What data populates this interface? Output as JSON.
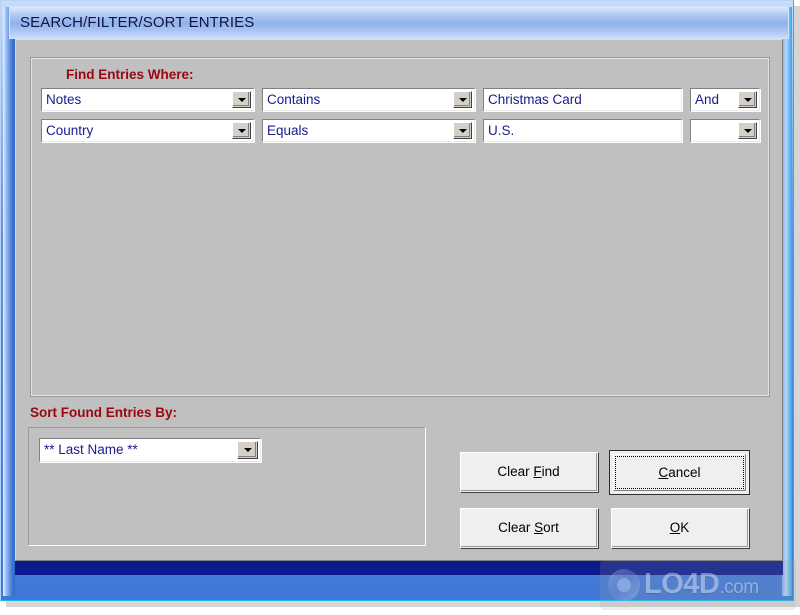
{
  "window": {
    "title": "SEARCH/FILTER/SORT ENTRIES",
    "title_color": "#14133f",
    "frame_color": "#3f78d8",
    "client_bg": "#c0c0c0",
    "label_color": "#9a0710",
    "field_text_color": "#1a1a8c"
  },
  "find_group": {
    "label": "Find Entries Where:",
    "rows": [
      {
        "field_combo": {
          "value": "Notes",
          "arrow": "chevron-down-icon"
        },
        "operator_combo": {
          "value": "Contains",
          "arrow": "chevron-down-icon"
        },
        "value_textbox": {
          "value": "Christmas Card",
          "placeholder": ""
        },
        "conjunction_combo": {
          "value": "And",
          "arrow": "chevron-down-icon"
        }
      },
      {
        "field_combo": {
          "value": "Country",
          "arrow": "chevron-down-icon"
        },
        "operator_combo": {
          "value": "Equals",
          "arrow": "chevron-down-icon"
        },
        "value_textbox": {
          "value": "U.S.",
          "placeholder": ""
        },
        "conjunction_combo": {
          "value": "",
          "arrow": "chevron-down-icon"
        }
      }
    ]
  },
  "sort_group": {
    "label": "Sort Found Entries By:",
    "sort_combo": {
      "value": "** Last Name **",
      "arrow": "chevron-down-icon"
    }
  },
  "buttons": {
    "clear_find": {
      "label": "Clear Find",
      "accel": "F",
      "default": false
    },
    "cancel": {
      "label": "Cancel",
      "accel": "C",
      "default": true
    },
    "clear_sort": {
      "label": "Clear Sort",
      "accel": "S",
      "default": false
    },
    "ok": {
      "label": "OK",
      "accel": "O",
      "default": false
    }
  },
  "watermark": {
    "text": "LO4D",
    "suffix": ".com"
  }
}
